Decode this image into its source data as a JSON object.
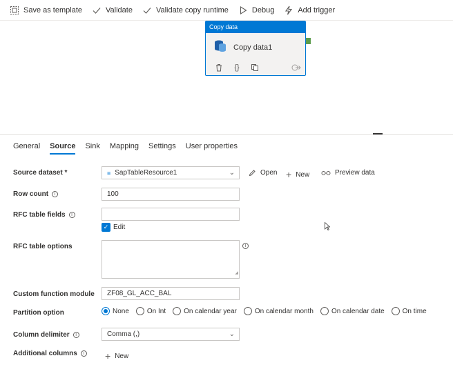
{
  "toolbar": {
    "items": [
      {
        "label": "Save as template",
        "icon": "template-icon"
      },
      {
        "label": "Validate",
        "icon": "check-icon"
      },
      {
        "label": "Validate copy runtime",
        "icon": "check-icon"
      },
      {
        "label": "Debug",
        "icon": "play-icon"
      },
      {
        "label": "Add trigger",
        "icon": "lightning-icon"
      }
    ]
  },
  "activity": {
    "type_label": "Copy data",
    "name": "Copy data1"
  },
  "tabs": [
    "General",
    "Source",
    "Sink",
    "Mapping",
    "Settings",
    "User properties"
  ],
  "active_tab": "Source",
  "form": {
    "source_dataset": {
      "label": "Source dataset *",
      "value": "SapTableResource1"
    },
    "actions": {
      "open": "Open",
      "new": "New",
      "preview": "Preview data"
    },
    "row_count": {
      "label": "Row count",
      "value": "100"
    },
    "rfc_table_fields": {
      "label": "RFC table fields",
      "value": "",
      "edit_label": "Edit"
    },
    "rfc_table_options": {
      "label": "RFC table options",
      "lines": [
        "",
        "",
        "",
        ""
      ]
    },
    "custom_function_module": {
      "label": "Custom function module",
      "value": "ZF08_GL_ACC_BAL"
    },
    "partition_option": {
      "label": "Partition option",
      "options": [
        "None",
        "On Int",
        "On calendar year",
        "On calendar month",
        "On calendar date",
        "On time"
      ],
      "selected": "None"
    },
    "column_delimiter": {
      "label": "Column delimiter",
      "value": "Comma (,)"
    },
    "additional_columns": {
      "label": "Additional columns",
      "new_label": "New"
    }
  },
  "colors": {
    "accent": "#0078d4",
    "handle": "#5c9c4b"
  }
}
